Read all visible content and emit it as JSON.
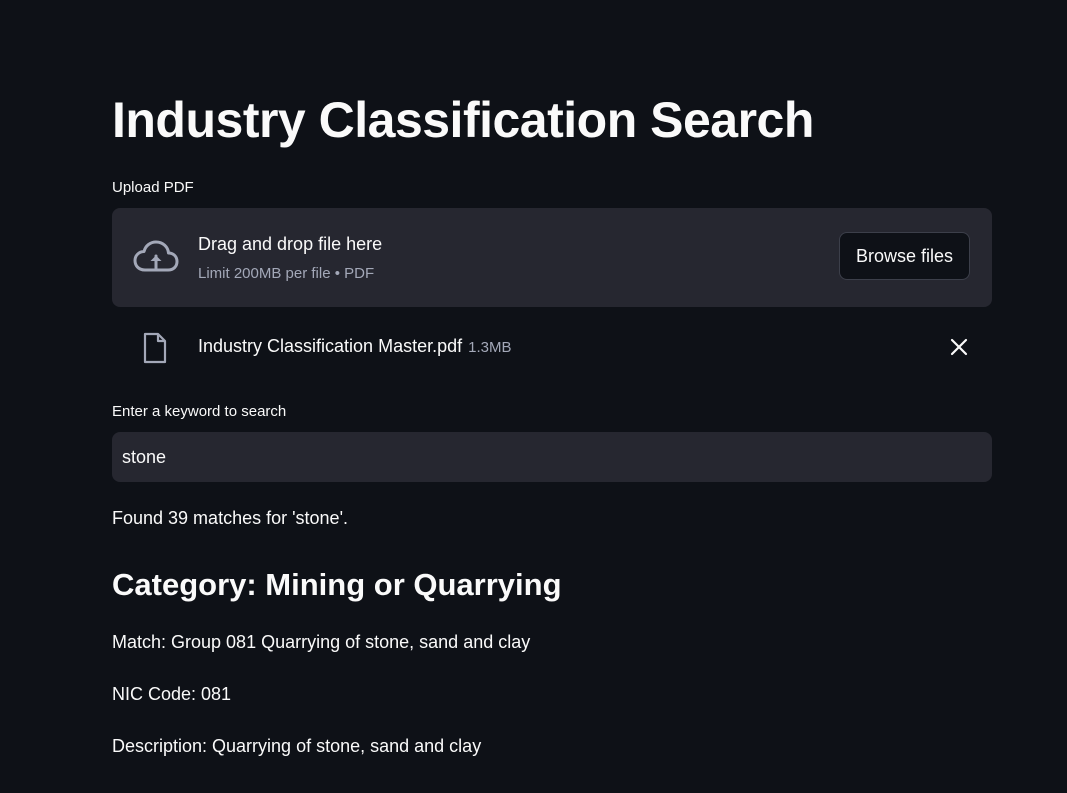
{
  "page": {
    "title": "Industry Classification Search"
  },
  "uploader": {
    "label": "Upload PDF",
    "drop_text": "Drag and drop file here",
    "limit_text": "Limit 200MB per file • PDF",
    "browse_label": "Browse files",
    "icon": "cloud-upload-icon"
  },
  "uploaded_file": {
    "name": "Industry Classification Master.pdf",
    "size": "1.3MB",
    "icon": "file-icon",
    "remove_icon": "close-icon"
  },
  "search": {
    "label": "Enter a keyword to search",
    "value": "stone"
  },
  "results": {
    "summary": "Found 39 matches for 'stone'.",
    "category_heading": "Category: Mining or Quarrying",
    "match": "Match: Group 081 Quarrying of stone, sand and clay",
    "nic_code": "NIC Code: 081",
    "description": "Description: Quarrying of stone, sand and clay"
  },
  "colors": {
    "background": "#0e1117",
    "widget_background": "#262730",
    "text": "#fafafa",
    "muted_text": "#a3a8b8"
  }
}
